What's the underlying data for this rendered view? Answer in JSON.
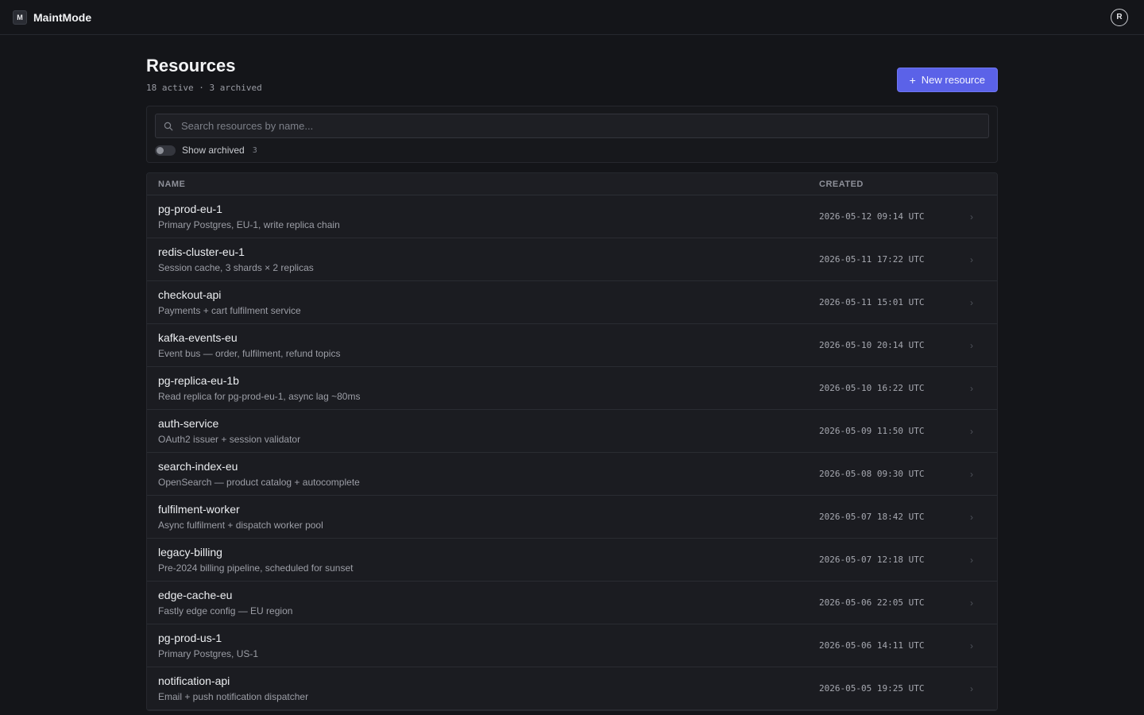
{
  "app": {
    "logo_text": "M",
    "name": "MaintMode"
  },
  "user": {
    "initial": "R"
  },
  "page": {
    "title": "Resources",
    "subtitle": "18 active · 3 archived",
    "new_button_label": "New resource"
  },
  "filters": {
    "search_placeholder": "Search resources by name...",
    "search_value": "",
    "show_archived_label": "Show archived",
    "archived_count": "3",
    "show_archived": false
  },
  "table": {
    "columns": [
      "NAME",
      "CREATED"
    ],
    "rows": [
      {
        "name": "pg-prod-eu-1",
        "desc": "Primary Postgres, EU-1, write replica chain",
        "created": "2026-05-12 09:14 UTC"
      },
      {
        "name": "redis-cluster-eu-1",
        "desc": "Session cache, 3 shards × 2 replicas",
        "created": "2026-05-11 17:22 UTC"
      },
      {
        "name": "checkout-api",
        "desc": "Payments + cart fulfilment service",
        "created": "2026-05-11 15:01 UTC"
      },
      {
        "name": "kafka-events-eu",
        "desc": "Event bus — order, fulfilment, refund topics",
        "created": "2026-05-10 20:14 UTC"
      },
      {
        "name": "pg-replica-eu-1b",
        "desc": "Read replica for pg-prod-eu-1, async lag ~80ms",
        "created": "2026-05-10 16:22 UTC"
      },
      {
        "name": "auth-service",
        "desc": "OAuth2 issuer + session validator",
        "created": "2026-05-09 11:50 UTC"
      },
      {
        "name": "search-index-eu",
        "desc": "OpenSearch — product catalog + autocomplete",
        "created": "2026-05-08 09:30 UTC"
      },
      {
        "name": "fulfilment-worker",
        "desc": "Async fulfilment + dispatch worker pool",
        "created": "2026-05-07 18:42 UTC"
      },
      {
        "name": "legacy-billing",
        "desc": "Pre-2024 billing pipeline, scheduled for sunset",
        "created": "2026-05-07 12:18 UTC"
      },
      {
        "name": "edge-cache-eu",
        "desc": "Fastly edge config — EU region",
        "created": "2026-05-06 22:05 UTC"
      },
      {
        "name": "pg-prod-us-1",
        "desc": "Primary Postgres, US-1",
        "created": "2026-05-06 14:11 UTC"
      },
      {
        "name": "notification-api",
        "desc": "Email + push notification dispatcher",
        "created": "2026-05-05 19:25 UTC"
      }
    ]
  },
  "colors": {
    "background": "#141519",
    "accent": "#5b62e8",
    "surface": "#1b1c21",
    "border": "#26282e"
  }
}
